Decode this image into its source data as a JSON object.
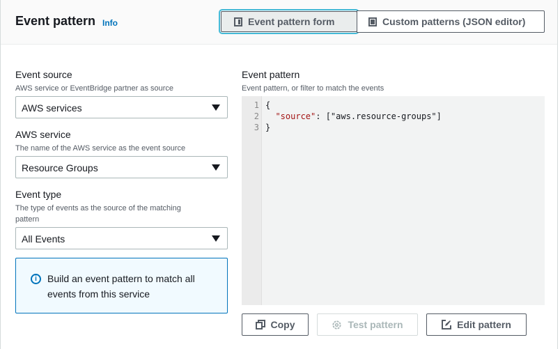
{
  "header": {
    "title": "Event pattern",
    "info": "Info",
    "tabs": [
      {
        "label": "Event pattern form",
        "selected": true
      },
      {
        "label": "Custom patterns (JSON editor)",
        "selected": false
      }
    ]
  },
  "form": {
    "event_source": {
      "label": "Event source",
      "hint": "AWS service or EventBridge partner as source",
      "value": "AWS services"
    },
    "aws_service": {
      "label": "AWS service",
      "hint": "The name of the AWS service as the event source",
      "value": "Resource Groups"
    },
    "event_type": {
      "label": "Event type",
      "hint": "The type of events as the source of the matching pattern",
      "value": "All Events"
    },
    "alert": {
      "text": "Build an event pattern to match all events from this service",
      "icon": "info-circle-icon"
    }
  },
  "pattern": {
    "label": "Event pattern",
    "hint": "Event pattern, or filter to match the events",
    "lines": [
      {
        "n": "1",
        "text": "{"
      },
      {
        "n": "2",
        "key": "\"source\"",
        "rest": ": [\"aws.resource-groups\"]"
      },
      {
        "n": "3",
        "text": "}"
      }
    ]
  },
  "buttons": {
    "copy": "Copy",
    "test": "Test pattern",
    "edit": "Edit pattern"
  }
}
